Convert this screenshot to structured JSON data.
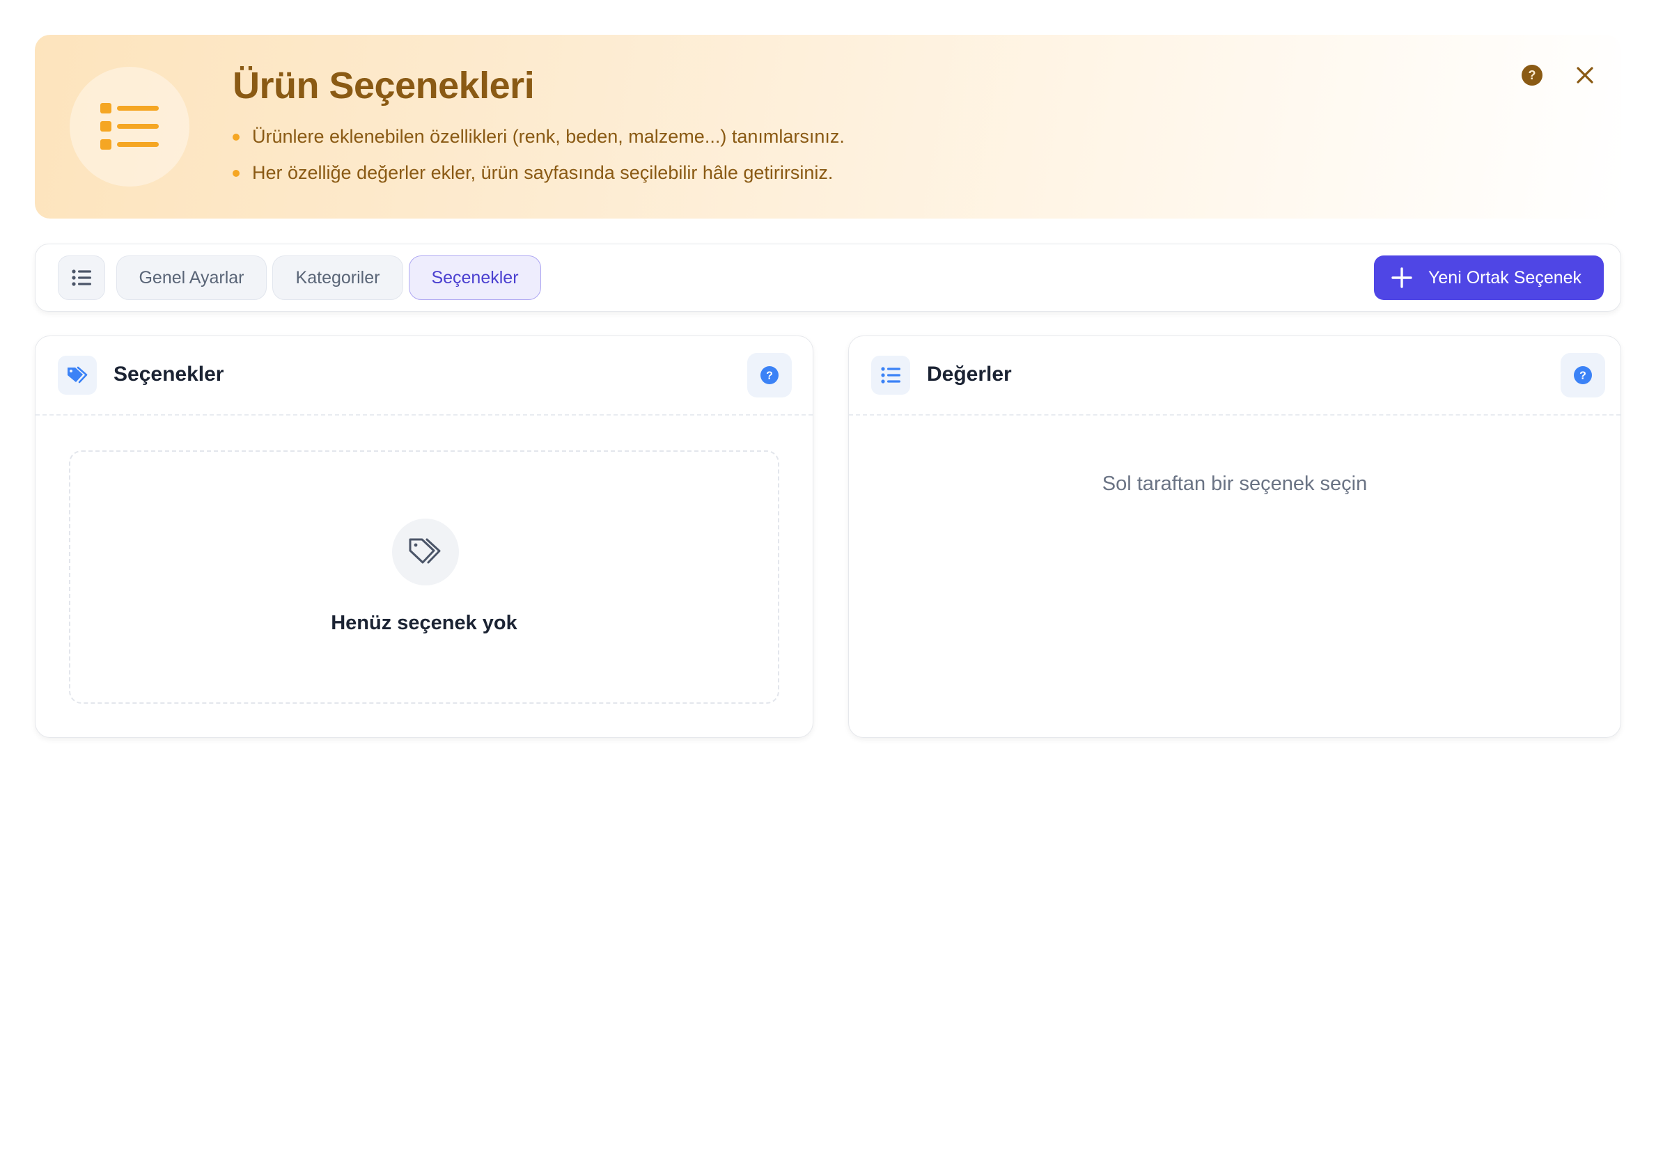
{
  "banner": {
    "title": "Ürün Seçenekleri",
    "bullets": [
      "Ürünlere eklenebilen özellikleri (renk, beden, malzeme...) tanımlarsınız.",
      "Her özelliğe değerler ekler, ürün sayfasında seçilebilir hâle getirirsiniz."
    ],
    "icon": "list-icon",
    "accent": "#f5a623",
    "title_color": "#8a5a14"
  },
  "toolbar": {
    "tabs": [
      {
        "label": "Genel Ayarlar",
        "active": false
      },
      {
        "label": "Kategoriler",
        "active": false
      },
      {
        "label": "Seçenekler",
        "active": true
      }
    ],
    "new_button_label": "Yeni Ortak Seçenek",
    "primary_color": "#4f46e5"
  },
  "options_panel": {
    "title": "Seçenekler",
    "icon": "tags-icon",
    "empty_text": "Henüz seçenek yok"
  },
  "values_panel": {
    "title": "Değerler",
    "icon": "list-icon",
    "hint": "Sol taraftan bir seçenek seçin"
  },
  "help_color": "#3b82f6"
}
